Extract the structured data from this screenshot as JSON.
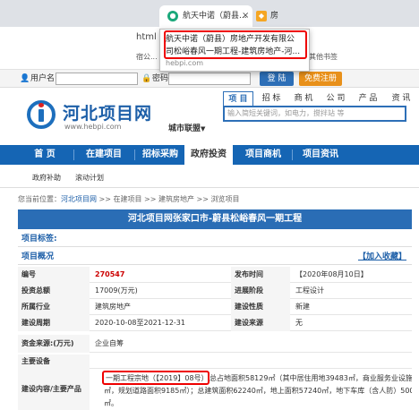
{
  "browser": {
    "tab_left_fragment": "",
    "active_tab_title": "航天中诺（蔚县...",
    "active_tab_favicon": "favicon-icon",
    "tab_close": "×",
    "second_tab_title": "房",
    "url_fragment": "html",
    "bookmark_fragment": "宿公...",
    "bookmark_right": "其他书签"
  },
  "tooltip": {
    "line1": "航天中诺（蔚县）房地产开发有限公",
    "line2": "司松峪春风一期工程-建筑房地产-河...",
    "url": "hebpi.com"
  },
  "login": {
    "username_label": "用户名",
    "password_label": "密码",
    "login_button": "登 陆",
    "register_button": "免费注册"
  },
  "header": {
    "logo_title": "河北项目网",
    "logo_url": "www.hebpi.com",
    "city_link": "城市联盟",
    "city_arrow": "▼",
    "search_tabs": [
      "项 目",
      "招 标",
      "商 机",
      "公 司",
      "产 品",
      "资 讯"
    ],
    "search_placeholder": "输入简短关键词，如电力，搅拌站 等"
  },
  "nav": {
    "items": [
      "首 页",
      "在建项目",
      "招标采购",
      "政府投资",
      "项目商机",
      "项目资讯"
    ],
    "active_index": 3,
    "sub_items": [
      "政府补助",
      "滚动计划"
    ]
  },
  "breadcrumb": {
    "prefix": "您当前位置：",
    "home": "河北项目网",
    "sep1": " >> ",
    "level1": "在建项目",
    "sep2": " >> ",
    "level2": "建筑房地产",
    "sep3": " >> ",
    "level3": "浏览项目"
  },
  "project": {
    "title": "河北项目网张家口市-蔚县松峪春风一期工程",
    "tags_label": "项目标签:",
    "overview_label": "项目概况",
    "follow_link": "【加入收藏】",
    "rows": [
      {
        "l1": "编号",
        "v1": "270547",
        "l2": "发布时间",
        "v2": "【2020年08月10日】"
      },
      {
        "l1": "投资总额",
        "v1": "17009(万元)",
        "l2": "进展阶段",
        "v2": "工程设计"
      },
      {
        "l1": "所属行业",
        "v1": "建筑房地产",
        "l2": "建设性质",
        "v2": "新建"
      },
      {
        "l1": "建设周期",
        "v1": "2020-10-08至2021-12-31",
        "l2": "建设来源",
        "v2": "无"
      }
    ],
    "funding_label": "资金来源:(万元)",
    "funding_value": "企业自筹",
    "equipment_label": "主要设备",
    "content_label": "建设内容/主要产品",
    "content_line1_highlight": "一期工程宗地（【2019】08号）",
    "content_line1_rest": "总占地面积58129㎡（其中居住用地39483㎡，商业服务业设施用地9461",
    "content_line2": "㎡，规划道路面积9185㎡）；总建筑面积62240㎡，地上面积57240㎡，地下车库（含人防）5000",
    "content_line3": "㎡。"
  },
  "colors": {
    "nav_blue": "#1565b4",
    "title_bar": "#2a6db5",
    "highlight_red": "#e00000",
    "code_red": "#cc0000"
  }
}
